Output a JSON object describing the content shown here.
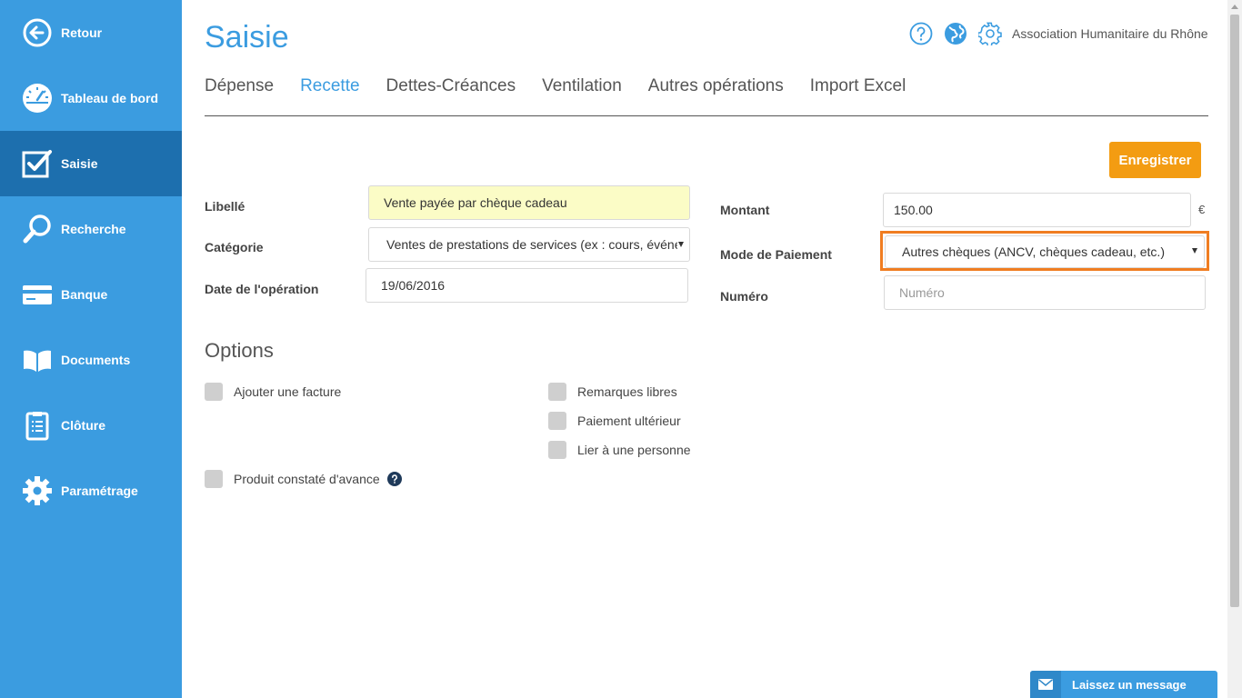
{
  "sidebar": {
    "items": [
      {
        "label": "Retour",
        "icon": "back-arrow-icon"
      },
      {
        "label": "Tableau de bord",
        "icon": "dashboard-gauge-icon"
      },
      {
        "label": "Saisie",
        "icon": "edit-checkbox-icon",
        "active": true
      },
      {
        "label": "Recherche",
        "icon": "search-icon"
      },
      {
        "label": "Banque",
        "icon": "credit-card-icon"
      },
      {
        "label": "Documents",
        "icon": "book-icon"
      },
      {
        "label": "Clôture",
        "icon": "clipboard-icon"
      },
      {
        "label": "Paramétrage",
        "icon": "gear-icon"
      }
    ]
  },
  "header": {
    "title": "Saisie",
    "organization": "Association Humanitaire du Rhône",
    "icons": [
      "help-icon",
      "globe-icon",
      "settings-icon"
    ]
  },
  "tabs": [
    {
      "label": "Dépense"
    },
    {
      "label": "Recette",
      "active": true
    },
    {
      "label": "Dettes-Créances"
    },
    {
      "label": "Ventilation"
    },
    {
      "label": "Autres opérations"
    },
    {
      "label": "Import Excel"
    }
  ],
  "toolbar": {
    "save_label": "Enregistrer"
  },
  "form": {
    "libelle": {
      "label": "Libellé",
      "value": "Vente payée par chèque cadeau"
    },
    "categorie": {
      "label": "Catégorie",
      "value": "Ventes de prestations de services (ex : cours, événen"
    },
    "date": {
      "label": "Date de l'opération",
      "value": "19/06/2016"
    },
    "montant": {
      "label": "Montant",
      "value": "150.00",
      "currency": "€"
    },
    "mode_paiement": {
      "label": "Mode de Paiement",
      "value": "Autres chèques (ANCV, chèques cadeau, etc.)"
    },
    "numero": {
      "label": "Numéro",
      "placeholder": "Numéro"
    }
  },
  "options": {
    "title": "Options",
    "items": {
      "ajouter_facture": "Ajouter une facture",
      "remarques_libres": "Remarques libres",
      "paiement_ulterieur": "Paiement ultérieur",
      "lier_personne": "Lier à une personne",
      "produit_constate": "Produit constaté d'avance"
    }
  },
  "message_widget": {
    "label": "Laissez un message"
  },
  "colors": {
    "sidebar": "#3b9ce0",
    "sidebar_active": "#1d6fae",
    "accent": "#3b9ce0",
    "save_button": "#f39c12",
    "highlight_frame": "#f07d21",
    "libelle_background": "#fbfcc6"
  }
}
